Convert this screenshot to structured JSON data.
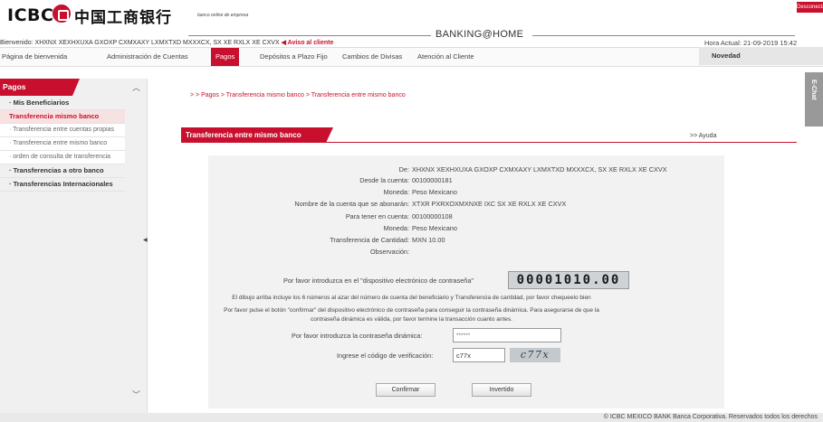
{
  "header": {
    "brand": "ICBC",
    "brand_cn": "中国工商银行",
    "subtitle": "banco online de empresa",
    "title": "BANKING@HOME",
    "disconnect_label": "Desconecta",
    "welcome": "Bienvenido: XHXNX XEXHXUXA GXOXP CXMXAXY LXMXTXD MXXXCX, SX XE RXLX XE CXVX",
    "aviso": "Aviso al cliente",
    "clock": "Hora Actual: 21-09-2019 15:42"
  },
  "nav": {
    "items": [
      {
        "label": "Página de bienvenida"
      },
      {
        "label": "Administración de Cuentas"
      },
      {
        "label": "Pagos",
        "active": true
      },
      {
        "label": "Depósitos a Plazo Fijo"
      },
      {
        "label": "Cambios de Divisas"
      },
      {
        "label": "Atención al Cliente"
      }
    ],
    "novedad": "Novedad"
  },
  "sidebar": {
    "title": "Pagos",
    "items": [
      {
        "label": "Mis Beneficiarios",
        "style": "bold"
      },
      {
        "label": "Transferencia mismo banco",
        "style": "hl"
      },
      {
        "label": "Transferencia entre cuentas propias",
        "style": "sub"
      },
      {
        "label": "Transferencia entre mismo banco",
        "style": "sub"
      },
      {
        "label": "orden de consulta de transferencia",
        "style": "sub"
      },
      {
        "label": "Transferencias a otro banco",
        "style": "bold"
      },
      {
        "label": "Transferencias Internacionales",
        "style": "bold"
      }
    ]
  },
  "main": {
    "breadcrumb": "> > Pagos > Transferencia mismo banco > Transferencia entre mismo banco",
    "panel_title": "Transferencia entre mismo banco",
    "help": ">> Ayuda",
    "fields": [
      {
        "label": "De:",
        "value": "XHXNX XEXHXUXA GXOXP CXMXAXY LXMXTXD MXXXCX, SX XE RXLX XE CXVX"
      },
      {
        "label": "Desde la cuenta:",
        "value": "00100000181"
      },
      {
        "label": "Moneda:",
        "value": "Peso Mexicano"
      },
      {
        "label": "Nombre de la cuenta que se abonarán:",
        "value": "XTXR PXRXOXMXNXE IXC SX XE RXLX XE CXVX"
      },
      {
        "label": "Para tener en cuenta:",
        "value": "00100000108"
      },
      {
        "label": "Moneda:",
        "value": "Peso Mexicano"
      },
      {
        "label": "Transferencia de Cantidad:",
        "value": "MXN 10.00"
      },
      {
        "label": "Observación:",
        "value": ""
      }
    ],
    "token_prompt": "Por favor introduzca en el \"dispositivo electrónico de contraseña\"",
    "token_value": "00001010.00",
    "note1": "El dibujo arriba incluye los 6 números al azar del número de cuenta del beneficiario y Transferencia de cantidad, por favor chequeelo bien",
    "note2": "Por favor pulse el botón \"confirmar\" del dispositivo electrónico de contraseña para conseguir la contraseña dinámica. Para asegurarse de que la",
    "note3": "contraseña dinámica es válida, por favor termine la transacción cuanto antes.",
    "pwd_label": "Por favor introduzca la contraseña dinámica:",
    "pwd_value": "******",
    "code_label": "Ingrese el código de verificación:",
    "code_value": "c77x",
    "captcha": "c77x",
    "confirm_label": "Confirmar",
    "invert_label": "Invertido"
  },
  "side_tab": "E-Chat",
  "footer": "© ICBC MEXICO BANK Banca Corporativa. Reservados todos los derechos"
}
